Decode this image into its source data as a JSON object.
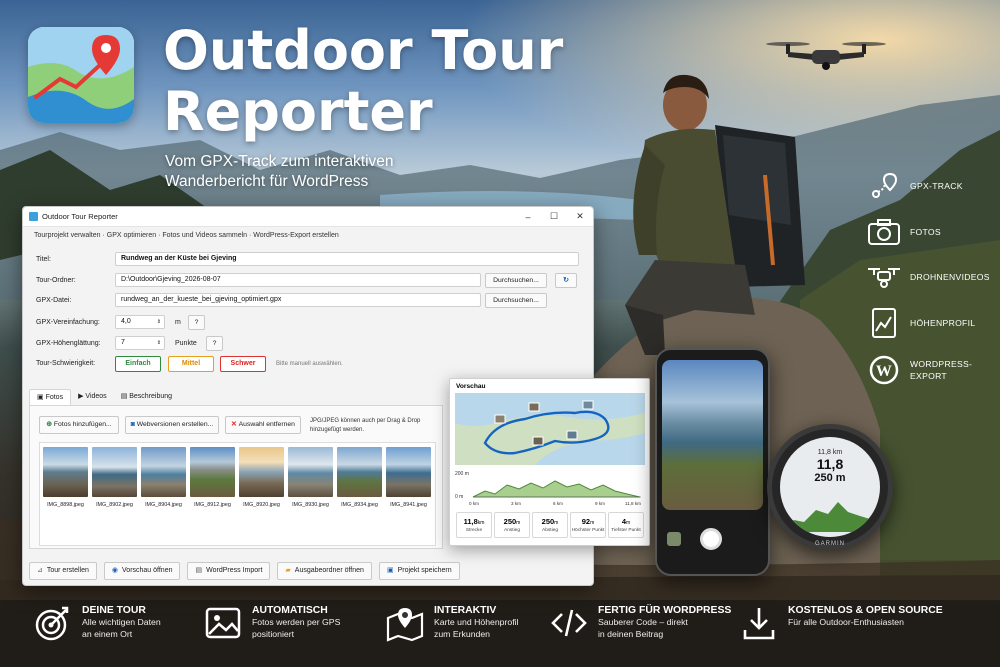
{
  "hero": {
    "title_line1": "Outdoor Tour",
    "title_line2": "Reporter",
    "subtitle_line1": "Vom GPX-Track zum interaktiven",
    "subtitle_line2": "Wanderbericht für WordPress"
  },
  "window": {
    "title": "Outdoor Tour Reporter",
    "menu": "Tourprojekt verwalten · GPX optimieren · Fotos und Videos sammeln · WordPress-Export erstellen",
    "title_label": "Titel:",
    "title_value": "Rundweg an der Küste bei Gjeving",
    "folder_label": "Tour-Ordner:",
    "folder_value": "D:\\Outdoor\\Gjeving_2026-08-07",
    "gpx_label": "GPX-Datei:",
    "gpx_value": "rundweg_an_der_kueste_bei_gjeving_optimiert.gpx",
    "browse1": "Durchsuchen...",
    "browse2": "Durchsuchen...",
    "simplify_label": "GPX-Vereinfachung:",
    "simplify_value": "4,0",
    "simplify_unit": "m",
    "smooth_label": "GPX-Höhenglättung:",
    "smooth_value": "7",
    "smooth_unit": "Punkte",
    "help": "?",
    "difficulty_label": "Tour-Schwierigkeit:",
    "difficulty": [
      "Einfach",
      "Mittel",
      "Schwer"
    ],
    "difficulty_hint": "Bitte manuell auswählen.",
    "tabs": [
      "Fotos",
      "Videos",
      "Beschreibung"
    ],
    "add_photos": "Fotos hinzufügen...",
    "web_versions": "Webversionen erstellen...",
    "remove": "Auswahl entfernen",
    "drop_hint_1": "JPG/JPEG können auch per Drag & Drop",
    "drop_hint_2": "hinzugefügt werden.",
    "photos": [
      "IMG_8898.jpeg",
      "IMG_8902.jpeg",
      "IMG_8904.jpeg",
      "IMG_8912.jpeg",
      "IMG_8920.jpeg",
      "IMG_8930.jpeg",
      "IMG_8934.jpeg",
      "IMG_8941.jpeg"
    ],
    "bottom_buttons": [
      "Tour erstellen",
      "Vorschau öffnen",
      "WordPress Import",
      "Ausgabeordner öffnen",
      "Projekt speichern"
    ]
  },
  "preview": {
    "title": "Vorschau",
    "y_ticks": [
      "200 m",
      "0 m"
    ],
    "x_ticks": [
      "0 km",
      "3 km",
      "6 km",
      "9 km",
      "11,8 km"
    ],
    "stats": [
      {
        "value": "11,8",
        "unit": "km",
        "label": "Strecke"
      },
      {
        "value": "250",
        "unit": "m",
        "label": "Anstieg"
      },
      {
        "value": "250",
        "unit": "m",
        "label": "Abstieg"
      },
      {
        "value": "92",
        "unit": "m",
        "label": "Höchster Punkt"
      },
      {
        "value": "4",
        "unit": "m",
        "label": "Tiefster Punkt"
      }
    ]
  },
  "watch": {
    "line1": "11,8 km",
    "line2": "11,8",
    "line3": "250 m",
    "brand": "GARMIN"
  },
  "features": [
    "GPX-TRACK",
    "FOTOS",
    "DROHNENVIDEOS",
    "HÖHENPROFIL",
    "WORDPRESS-",
    "EXPORT"
  ],
  "bottom": [
    {
      "title": "DEINE TOUR",
      "l1": "Alle wichtigen Daten",
      "l2": "an einem Ort"
    },
    {
      "title": "AUTOMATISCH",
      "l1": "Fotos werden per GPS",
      "l2": "positioniert"
    },
    {
      "title": "INTERAKTIV",
      "l1": "Karte und Höhenprofil",
      "l2": "zum Erkunden"
    },
    {
      "title": "FERTIG FÜR WORDPRESS",
      "l1": "Sauberer Code – direkt",
      "l2": "in deinen Beitrag"
    },
    {
      "title": "KOSTENLOS & OPEN SOURCE",
      "l1": "Für alle Outdoor-Enthusiasten",
      "l2": ""
    }
  ]
}
